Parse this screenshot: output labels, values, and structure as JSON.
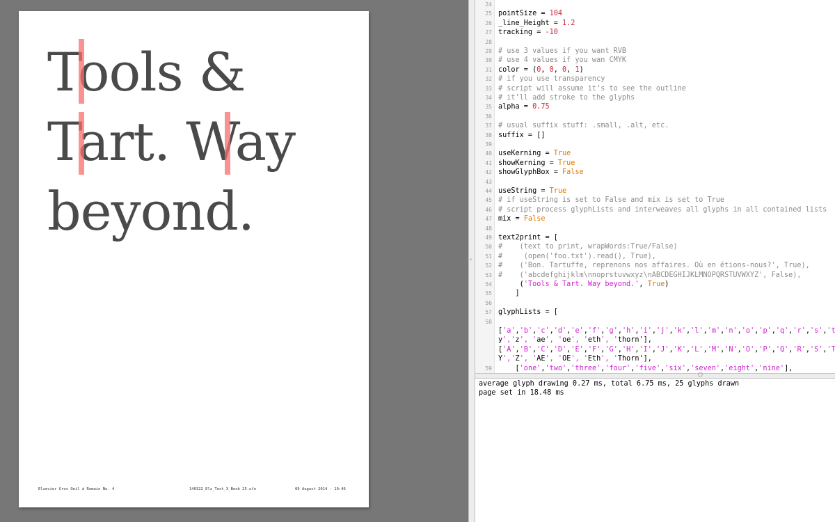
{
  "page_preview": {
    "text_lines": [
      "Tools &",
      "Tart. Way",
      "beyond."
    ],
    "footer": {
      "font_name": "Elzevier Gros Oeil à Romain No. 4",
      "file_name": "140322_Elz_Text_X_Book 25.ufo",
      "date": "09 August 2014 - 19:46"
    }
  },
  "code": {
    "lines": [
      {
        "n": "24",
        "t": ""
      },
      {
        "n": "25",
        "t": "pointSize = 104"
      },
      {
        "n": "26",
        "t": "_line_Height = 1.2"
      },
      {
        "n": "27",
        "t": "tracking = -10"
      },
      {
        "n": "28",
        "t": ""
      },
      {
        "n": "29",
        "t": "# use 3 values if you want RVB"
      },
      {
        "n": "30",
        "t": "# use 4 values if you wan CMYK"
      },
      {
        "n": "31",
        "t": "color = (0, 0, 0, 1)"
      },
      {
        "n": "32",
        "t": "# if you use transparency"
      },
      {
        "n": "33",
        "t": "# script will assume it’s to see the outline"
      },
      {
        "n": "34",
        "t": "# it’ll add stroke to the glyphs"
      },
      {
        "n": "35",
        "t": "alpha = 0.75"
      },
      {
        "n": "36",
        "t": ""
      },
      {
        "n": "37",
        "t": "# usual suffix stuff: .small, .alt, etc."
      },
      {
        "n": "38",
        "t": "suffix = []"
      },
      {
        "n": "39",
        "t": ""
      },
      {
        "n": "40",
        "t": "useKerning = True"
      },
      {
        "n": "41",
        "t": "showKerning = True"
      },
      {
        "n": "42",
        "t": "showGlyphBox = False"
      },
      {
        "n": "43",
        "t": ""
      },
      {
        "n": "44",
        "t": "useString = True"
      },
      {
        "n": "45",
        "t": "# if useString is set to False and mix is set to True"
      },
      {
        "n": "46",
        "t": "# script process glyphLists and interweaves all glyphs in all contained lists"
      },
      {
        "n": "47",
        "t": "mix = False"
      },
      {
        "n": "48",
        "t": ""
      },
      {
        "n": "49",
        "t": "text2print = ["
      },
      {
        "n": "50",
        "t": "#    (text to print, wrapWords:True/False)"
      },
      {
        "n": "51",
        "t": "#     (open('foo.txt').read(), True),"
      },
      {
        "n": "52",
        "t": "#    ('Bon. Tartuffe, reprenons nos affaires. Où en étions-nous?', True),"
      },
      {
        "n": "53",
        "t": "#    ('abcdefghijklm\\nnoprstuvwxyz\\nABCDEGHIJKLMNOPQRSTUVWXYZ', False),"
      },
      {
        "n": "54",
        "t": "     ('Tools & Tart. Way beyond.', True)"
      },
      {
        "n": "55",
        "t": "    ]"
      },
      {
        "n": "56",
        "t": ""
      },
      {
        "n": "57",
        "t": "glyphLists = ["
      },
      {
        "n": "58",
        "t": ""
      },
      {
        "n": "",
        "t": "['a','b','c','d','e','f','g','h','i','j','k','l','m','n','o','p','q','r','s','t','"
      },
      {
        "n": "",
        "t": "y','z', 'ae', 'oe', 'eth', 'thorn'],"
      },
      {
        "n": "",
        "t": "['A','B','C','D','E','F','G','H','I','J','K','L','M','N','O','P','Q','R','S','T','"
      },
      {
        "n": "",
        "t": "Y','Z', 'AE', 'OE', 'Eth', 'Thorn'],"
      },
      {
        "n": "59",
        "t": "    ['one','two','three','four','five','six','seven','eight','nine'],"
      }
    ]
  },
  "console": {
    "lines": [
      "average glyph drawing 0.27 ms, total 6.75 ms, 25 glyphs drawn",
      "page set in 18.48 ms"
    ]
  },
  "colors": {
    "comment": "#8c8c8c",
    "number": "#c8283c",
    "keyword": "#e07800",
    "string": "#d01fd0",
    "kerning_bar": "#fa6e6e",
    "glyph_fill": "#4a4a4a"
  }
}
